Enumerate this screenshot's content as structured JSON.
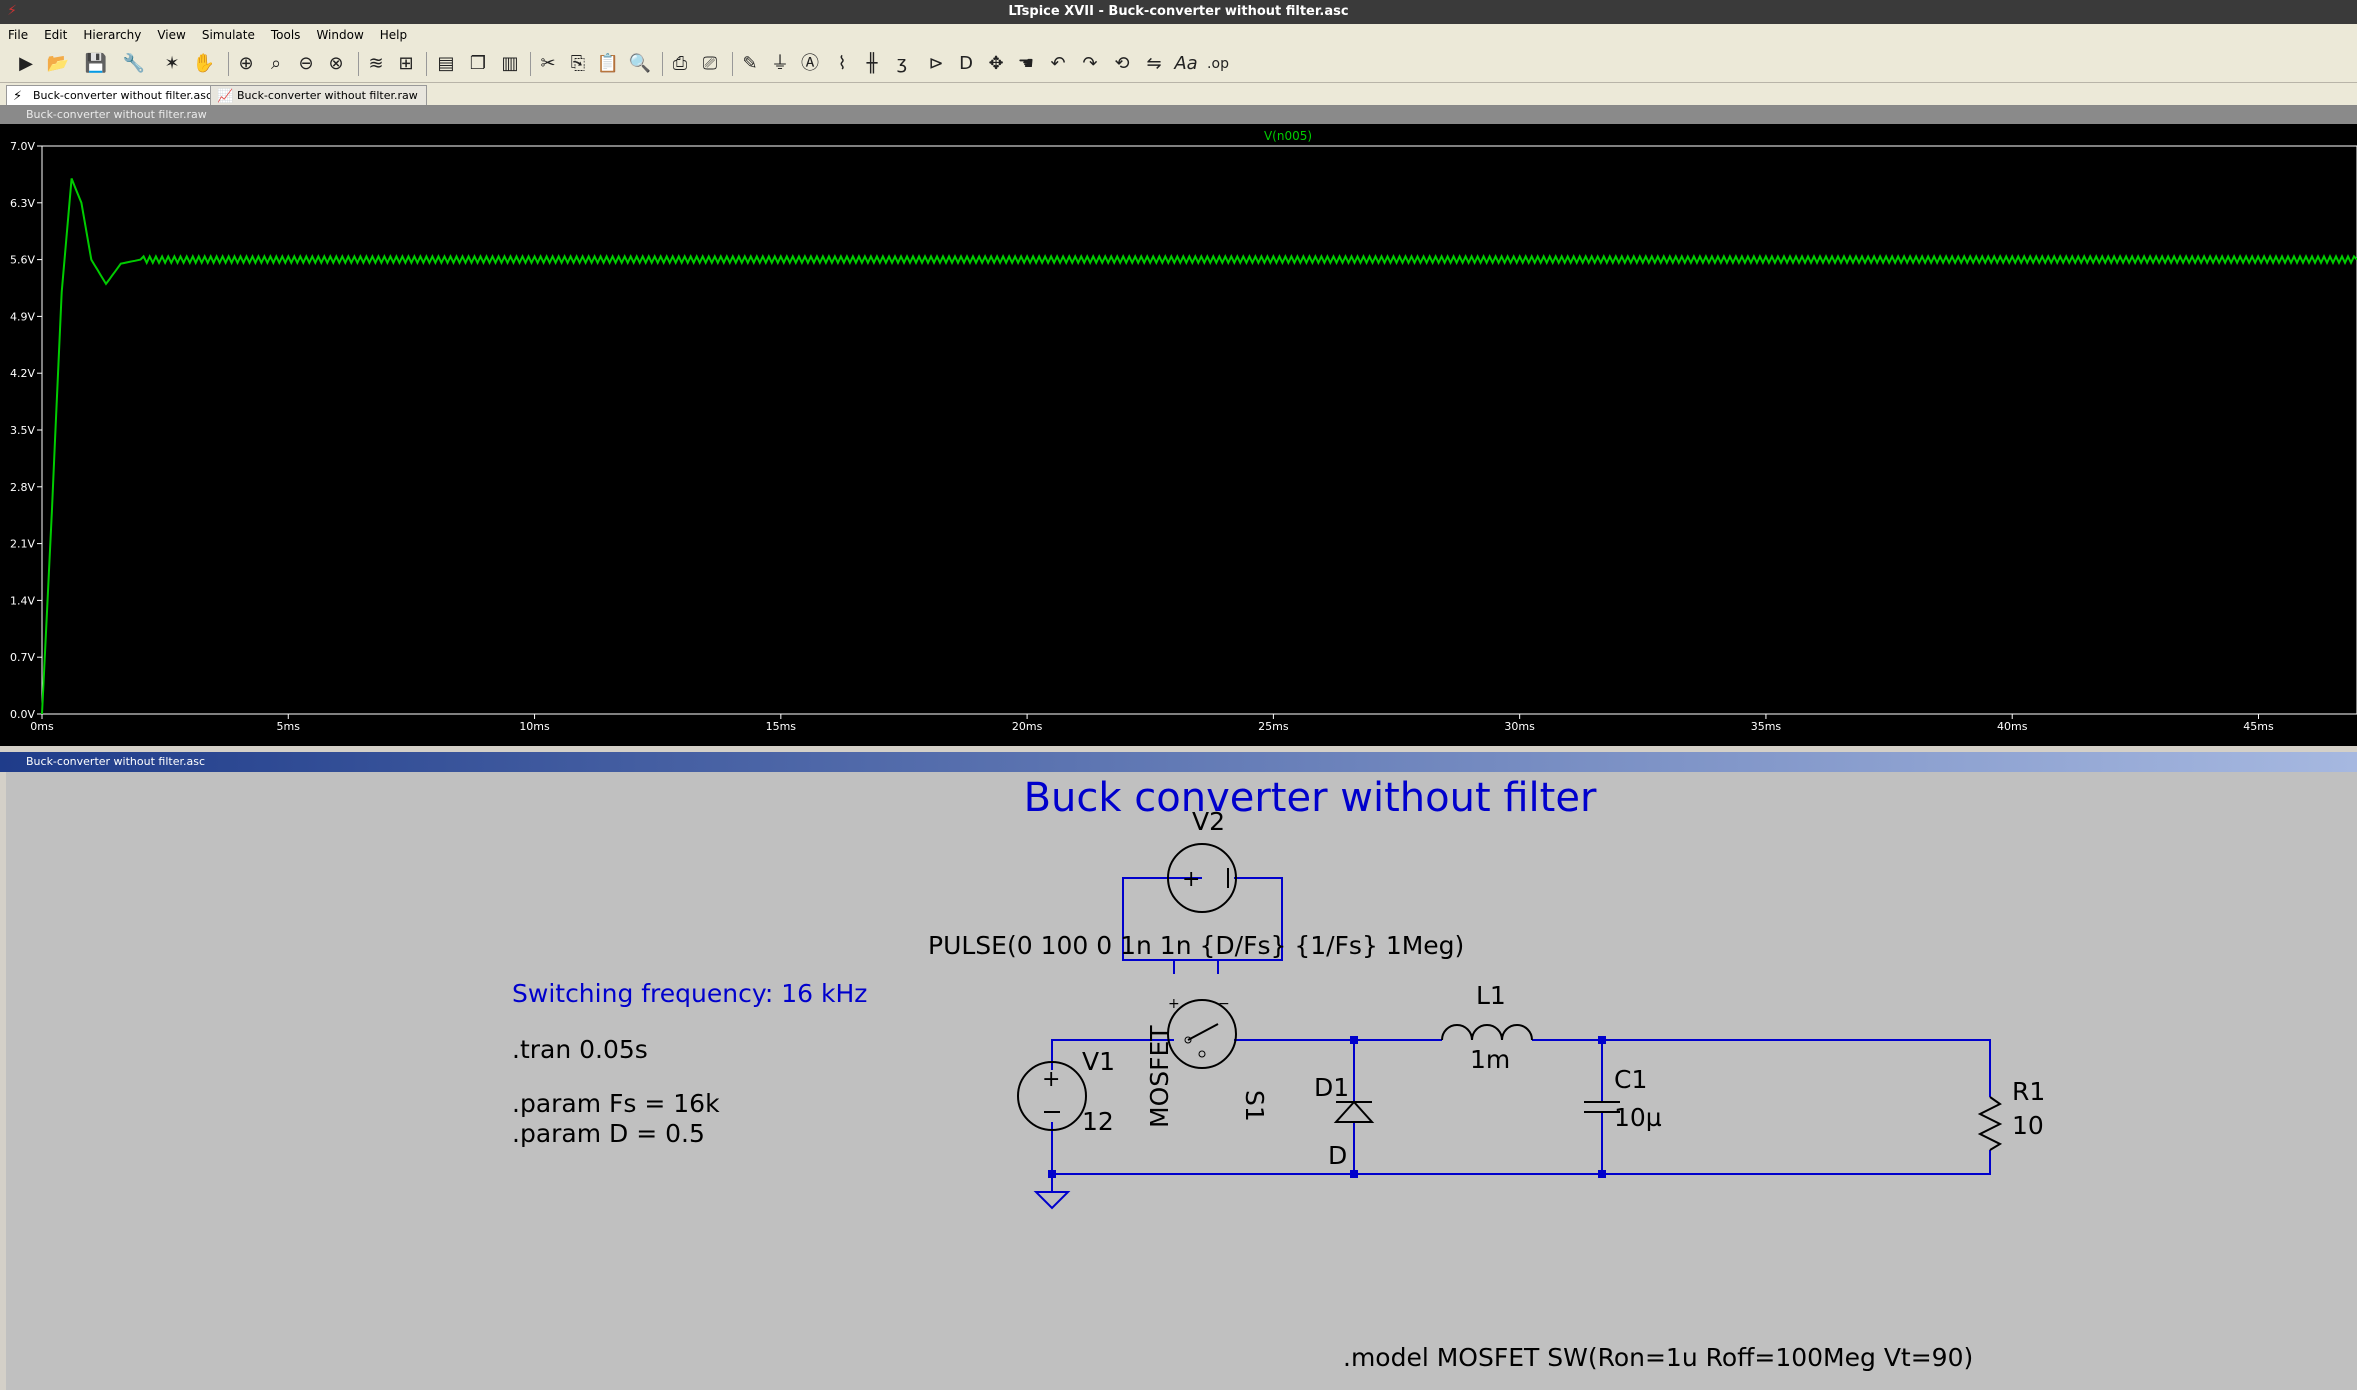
{
  "window": {
    "title": "LTspice XVII - Buck-converter without filter.asc"
  },
  "menu": [
    "File",
    "Edit",
    "Hierarchy",
    "View",
    "Simulate",
    "Tools",
    "Window",
    "Help"
  ],
  "toolbar": {
    "icons": [
      "run-icon",
      "open-icon",
      "save-icon",
      "control-panel-icon",
      "halt-icon",
      "hand-icon",
      "zoom-in-icon",
      "zoom-pan-icon",
      "zoom-out-icon",
      "zoom-fit-icon",
      "autorange-icon",
      "grid-icon",
      "tile-h-icon",
      "cascade-icon",
      "tile-v-icon",
      "cut-icon",
      "copy-icon",
      "paste-icon",
      "find-icon",
      "print-icon",
      "print-preview-icon",
      "wire-icon",
      "ground-icon",
      "label-icon",
      "resistor-icon",
      "capacitor-icon",
      "inductor-icon",
      "diode-icon",
      "component-icon",
      "move-icon",
      "drag-icon",
      "undo-icon",
      "redo-icon",
      "rotate-icon",
      "mirror-icon",
      "text-icon",
      "spice-directive-icon"
    ]
  },
  "tabs": [
    {
      "label": "Buck-converter without filter.asc"
    },
    {
      "label": "Buck-converter without filter.raw"
    }
  ],
  "waveform": {
    "title": "Buck-converter without filter.raw",
    "trace_label": "V(n005)",
    "trace_color": "#00cc00",
    "chart_data": {
      "type": "line",
      "series": [
        {
          "name": "V(n005)",
          "x": [
            0,
            0.2,
            0.4,
            0.6,
            0.8,
            1.0,
            1.3,
            1.6,
            2.0,
            3,
            5,
            10,
            20,
            30,
            40,
            47
          ],
          "values": [
            0,
            2.5,
            5.2,
            6.6,
            6.3,
            5.6,
            5.3,
            5.55,
            5.6,
            5.6,
            5.6,
            5.6,
            5.6,
            5.6,
            5.6,
            5.6
          ]
        }
      ],
      "xlim": [
        0,
        47
      ],
      "ylim": [
        0,
        7.0
      ],
      "x_ticks": [
        "0ms",
        "5ms",
        "10ms",
        "15ms",
        "20ms",
        "25ms",
        "30ms",
        "35ms",
        "40ms",
        "45ms"
      ],
      "y_ticks": [
        "0.0V",
        "0.7V",
        "1.4V",
        "2.1V",
        "2.8V",
        "3.5V",
        "4.2V",
        "4.9V",
        "5.6V",
        "6.3V",
        "7.0V"
      ]
    }
  },
  "schematic": {
    "title_bar": "Buck-converter without filter.asc",
    "heading": "Buck converter without filter",
    "comment_freq": "Switching frequency: 16 kHz",
    "tran": ".tran 0.05s",
    "param_fs": ".param Fs = 16k",
    "param_d": ".param D = 0.5",
    "model": ".model MOSFET SW(Ron=1u Roff=100Meg Vt=90)",
    "v2_name": "V2",
    "v2_value": "PULSE(0 100 0 1n 1n {D/Fs} {1/Fs} 1Meg)",
    "v1_name": "V1",
    "v1_value": "12",
    "s1_name": "S1",
    "s1_model": "MOSFET",
    "d1_name": "D1",
    "d1_model": "D",
    "l1_name": "L1",
    "l1_value": "1m",
    "c1_name": "C1",
    "c1_value": "10µ",
    "r1_name": "R1",
    "r1_value": "10",
    "wire_color": "#0000cc",
    "text_color": "#000000",
    "comment_color": "#0000cc"
  }
}
